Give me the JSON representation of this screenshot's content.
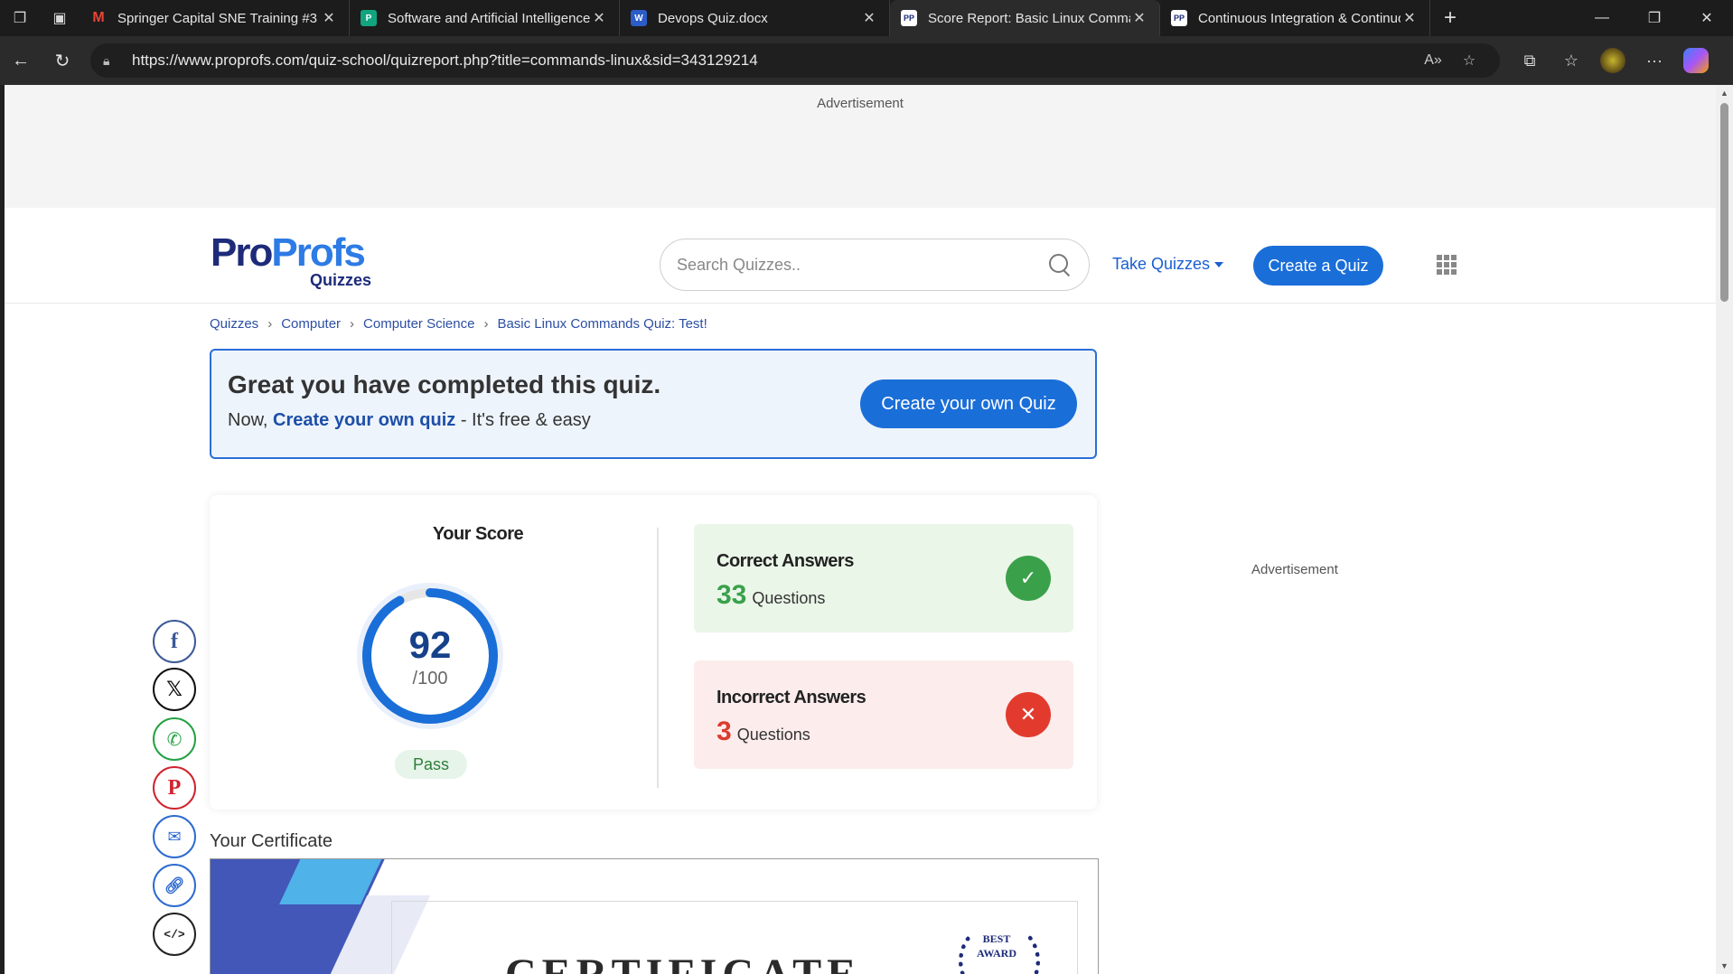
{
  "browser": {
    "tabs": [
      {
        "title": "Springer Capital SNE Training #3",
        "icon": "gmail-icon",
        "color": "#ea4335",
        "glyph": "M",
        "active": false
      },
      {
        "title": "Software and Artificial Intelligence",
        "icon": "planner-icon",
        "color": "#12a37f",
        "glyph": "P",
        "active": false
      },
      {
        "title": "Devops Quiz.docx",
        "icon": "word-icon",
        "color": "#2b5cc7",
        "glyph": "W",
        "active": false
      },
      {
        "title": "Score Report: Basic Linux Commands",
        "icon": "proprofs-icon",
        "color": "#ffffff",
        "glyph": "PP",
        "active": true
      },
      {
        "title": "Continuous Integration & Continuous",
        "icon": "proprofs-icon",
        "color": "#ffffff",
        "glyph": "PP",
        "active": false
      }
    ],
    "url": "https://www.proprofs.com/quiz-school/quizreport.php?title=commands-linux&sid=343129214"
  },
  "ads": {
    "top_label": "Advertisement",
    "side_label": "Advertisement"
  },
  "header": {
    "logo_main_1": "Pro",
    "logo_main_2": "Profs",
    "logo_sub": "Quizzes",
    "search_placeholder": "Search Quizzes..",
    "take_quizzes": "Take Quizzes",
    "create_quiz": "Create a Quiz"
  },
  "breadcrumb": [
    "Quizzes",
    "Computer",
    "Computer Science",
    "Basic Linux Commands Quiz: Test!"
  ],
  "completion": {
    "heading": "Great you have completed this quiz.",
    "prefix": "Now, ",
    "link": "Create your own quiz",
    "suffix": " - It's free & easy",
    "button": "Create your own Quiz"
  },
  "score": {
    "label": "Your Score",
    "value": "92",
    "out_of": "/100",
    "fraction": 0.92,
    "status": "Pass",
    "correct": {
      "title": "Correct Answers",
      "count": "33",
      "unit": "Questions"
    },
    "incorrect": {
      "title": "Incorrect Answers",
      "count": "3",
      "unit": "Questions"
    }
  },
  "certificate": {
    "title": "Your Certificate",
    "heading": "CERTIFICATE",
    "award_line1": "BEST",
    "award_line2": "AWARD"
  },
  "colors": {
    "accent": "#1a6ed8",
    "correct": "#3aa14a",
    "incorrect": "#e23b2e"
  }
}
